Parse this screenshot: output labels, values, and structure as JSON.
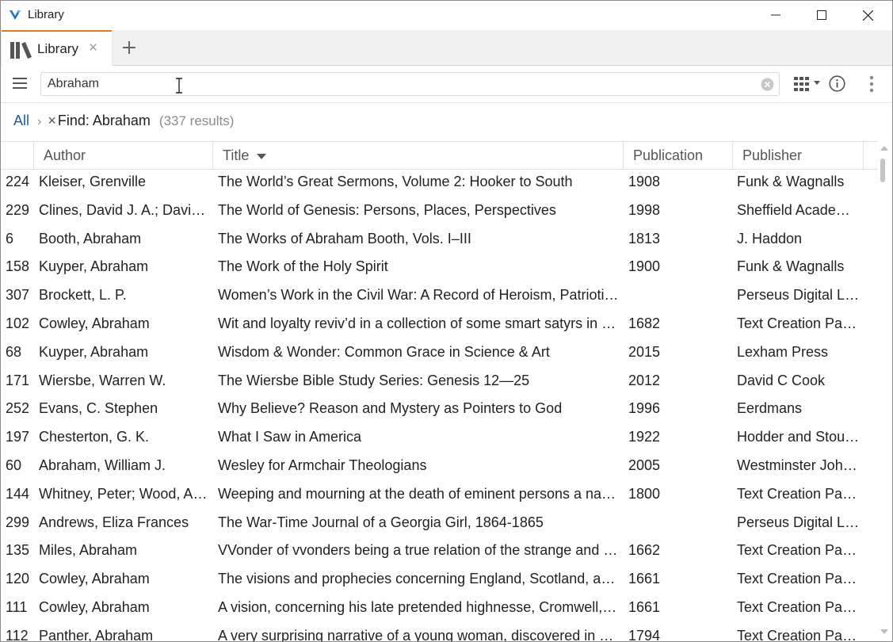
{
  "window": {
    "title": "Library"
  },
  "tabs": [
    {
      "label": "Library",
      "close": "×"
    }
  ],
  "search": {
    "value": "Abraham"
  },
  "breadcrumb": {
    "all": "All",
    "separator": "›",
    "filter_remove": "×",
    "filter": "Find: Abraham",
    "count": "(337 results)"
  },
  "table": {
    "headers": {
      "author": "Author",
      "title": "Title",
      "publication": "Publication",
      "publisher": "Publisher"
    },
    "sort": {
      "column": "Title",
      "direction": "descending"
    },
    "rows": [
      {
        "num": "224",
        "author": "Kleiser, Grenville",
        "title": "The World’s Great Sermons, Volume 2: Hooker to South",
        "publication": "1908",
        "publisher": "Funk & Wagnalls"
      },
      {
        "num": "229",
        "author": "Clines, David J. A.; Davies, Philip R.",
        "title": "The World of Genesis: Persons, Places, Perspectives",
        "publication": "1998",
        "publisher": "Sheffield Academic Press"
      },
      {
        "num": "6",
        "author": "Booth, Abraham",
        "title": "The Works of Abraham Booth, Vols. I–III",
        "publication": "1813",
        "publisher": "J. Haddon"
      },
      {
        "num": "158",
        "author": "Kuyper, Abraham",
        "title": "The Work of the Holy Spirit",
        "publication": "1900",
        "publisher": "Funk & Wagnalls"
      },
      {
        "num": "307",
        "author": "Brockett, L. P.",
        "title": "Women’s Work in the Civil War: A Record of Heroism, Patriotism and Patience",
        "publication": "",
        "publisher": "Perseus Digital Library"
      },
      {
        "num": "102",
        "author": "Cowley, Abraham",
        "title": "Wit and loyalty reviv’d in a collection of some smart satyrs in verse and prose",
        "publication": "1682",
        "publisher": "Text Creation Partnership"
      },
      {
        "num": "68",
        "author": "Kuyper, Abraham",
        "title": "Wisdom & Wonder: Common Grace in Science & Art",
        "publication": "2015",
        "publisher": "Lexham Press"
      },
      {
        "num": "171",
        "author": "Wiersbe, Warren W.",
        "title": "The Wiersbe Bible Study Series: Genesis 12—25",
        "publication": "2012",
        "publisher": "David C Cook"
      },
      {
        "num": "252",
        "author": "Evans, C. Stephen",
        "title": "Why Believe? Reason and Mystery as Pointers to God",
        "publication": "1996",
        "publisher": "Eerdmans"
      },
      {
        "num": "197",
        "author": "Chesterton, G. K.",
        "title": "What I Saw in America",
        "publication": "1922",
        "publisher": "Hodder and Stoughton"
      },
      {
        "num": "60",
        "author": "Abraham, William J.",
        "title": "Wesley for Armchair Theologians",
        "publication": "2005",
        "publisher": "Westminster John Knox Press"
      },
      {
        "num": "144",
        "author": "Whitney, Peter; Wood, Abraham",
        "title": "Weeping and mourning at the death of eminent persons a national calamity",
        "publication": "1800",
        "publisher": "Text Creation Partnership"
      },
      {
        "num": "299",
        "author": "Andrews, Eliza Frances",
        "title": "The War-Time Journal of a Georgia Girl, 1864-1865",
        "publication": "",
        "publisher": "Perseus Digital Library"
      },
      {
        "num": "135",
        "author": "Miles, Abraham",
        "title": "VVonder of vvonders being a true relation of the strange and invisible beast",
        "publication": "1662",
        "publisher": "Text Creation Partnership"
      },
      {
        "num": "120",
        "author": "Cowley, Abraham",
        "title": "The visions and prophecies concerning England, Scotland, and Ireland",
        "publication": "1661",
        "publisher": "Text Creation Partnership"
      },
      {
        "num": "111",
        "author": "Cowley, Abraham",
        "title": "A vision, concerning his late pretended highnesse, Cromwell, the wicked",
        "publication": "1661",
        "publisher": "Text Creation Partnership"
      },
      {
        "num": "112",
        "author": "Panther, Abraham",
        "title": "A very surprising narrative of a young woman, discovered in a rocky cave",
        "publication": "1794",
        "publisher": "Text Creation Partnership"
      }
    ]
  },
  "icons": {
    "app_logo": "logos-v-logo",
    "minimize": "minimize-icon",
    "maximize": "maximize-icon",
    "close": "close-icon",
    "library": "books-icon",
    "add_tab": "plus-icon",
    "menu": "hamburger-icon",
    "clear": "clear-circle-icon",
    "view": "grid-view-icon",
    "info": "info-icon",
    "more": "kebab-icon"
  },
  "colors": {
    "accent": "#e87722",
    "link": "#1f5b9e",
    "logo": "#1a73c8"
  }
}
